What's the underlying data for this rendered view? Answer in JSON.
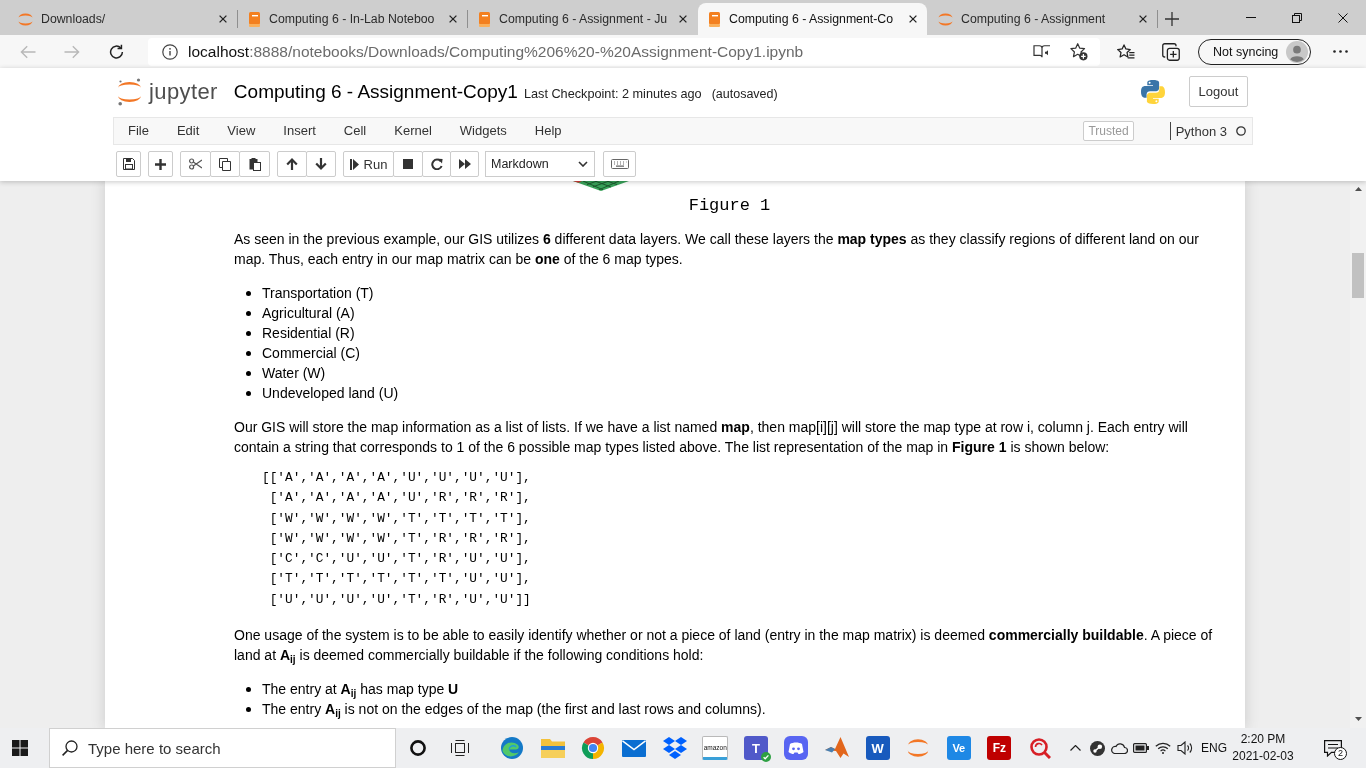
{
  "browser": {
    "tabs": [
      {
        "kind": "jupyter",
        "title": "Downloads/",
        "selected": false
      },
      {
        "kind": "notebook",
        "title": "Computing 6 - In-Lab Noteboo",
        "selected": false
      },
      {
        "kind": "notebook",
        "title": "Computing 6 - Assignment - Ju",
        "selected": false
      },
      {
        "kind": "notebook",
        "title": "Computing 6 - Assignment-Co",
        "selected": true
      },
      {
        "kind": "jupyter",
        "title": "Computing 6 - Assignment",
        "selected": false
      }
    ],
    "back_disabled": true,
    "forward_disabled": true,
    "address": {
      "host": "localhost",
      "path": ":8888/notebooks/Downloads/Computing%206%20-%20Assignment-Copy1.ipynb"
    },
    "profile": "Not syncing"
  },
  "notebook_header": {
    "logo_text": "jupyter",
    "title": "Computing 6 - Assignment-Copy1",
    "checkpoint": "Last Checkpoint: 2 minutes ago",
    "autosave": "(autosaved)",
    "logout": "Logout"
  },
  "menubar": {
    "items": [
      "File",
      "Edit",
      "View",
      "Insert",
      "Cell",
      "Kernel",
      "Widgets",
      "Help"
    ],
    "trusted": "Trusted",
    "kernel": "Python 3",
    "kernel_busy": false
  },
  "toolbar": {
    "run": "Run",
    "cell_type": "Markdown"
  },
  "notebook": {
    "blocks": [
      {
        "kind": "figure",
        "caption": "Figure 1"
      },
      {
        "kind": "paragraph",
        "text": "As seen in the previous example, our GIS utilizes **6** different data layers. We call these layers the **map types** as they classify regions of different land on our map. Thus, each entry in our map matrix can be **one** of the 6 map types."
      },
      {
        "kind": "list",
        "items": [
          "Transportation (T)",
          "Agricultural (A)",
          "Residential (R)",
          "Commercial (C)",
          "Water (W)",
          "Undeveloped land (U)"
        ]
      },
      {
        "kind": "paragraph",
        "text": "Our GIS will store the map information as a list of lists. If we have a list named **map**, then map[i][j] will store the map type at row i, column j. Each entry will contain a string that corresponds to 1 of the 6 possible map types listed above. The list representation of the map in **Figure 1** is shown below:"
      },
      {
        "kind": "code",
        "lines": [
          "[['A','A','A','A','U','U','U','U'],",
          " ['A','A','A','A','U','R','R','R'],",
          " ['W','W','W','W','T','T','T','T'],",
          " ['W','W','W','W','T','R','R','R'],",
          " ['C','C','U','U','T','R','U','U'],",
          " ['T','T','T','T','T','T','U','U'],",
          " ['U','U','U','U','T','R','U','U']]"
        ]
      },
      {
        "kind": "paragraph",
        "text": "One usage of the system is to be able to easily identify whether or not a piece of land (entry in the map matrix) is deemed **commercially buildable**. A piece of land at **A**$_{ij}$ is deemed commercially buildable if the following conditions hold:"
      },
      {
        "kind": "list",
        "items": [
          "The entry at **A**$_{ij}$ has map type **U**",
          "The entry **A**$_{ij}$ is not on the edges of the map (the first and last rows and columns)."
        ]
      }
    ]
  },
  "taskbar": {
    "search": {
      "placeholder": "Type here to search"
    },
    "apps": [
      {
        "kind": "edge"
      },
      {
        "kind": "explorer"
      },
      {
        "kind": "chrome"
      },
      {
        "kind": "mail"
      },
      {
        "kind": "dropbox"
      },
      {
        "kind": "amazon",
        "label": "amazon"
      },
      {
        "kind": "teams",
        "label": "T"
      },
      {
        "kind": "discord"
      },
      {
        "kind": "matlab"
      },
      {
        "kind": "word",
        "label": "W"
      },
      {
        "kind": "jupyter"
      },
      {
        "kind": "ve",
        "label": "Ve"
      },
      {
        "kind": "filezilla",
        "label": "Fz"
      },
      {
        "kind": "redapp"
      }
    ],
    "language": "ENG",
    "time": "2:20 PM",
    "date": "2021-02-03",
    "notifications": "2"
  }
}
